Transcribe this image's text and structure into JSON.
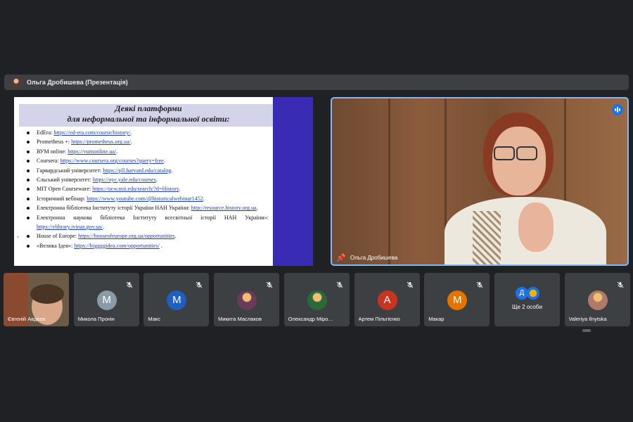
{
  "presenter_bar": {
    "title": "Ольга Дробишева (Презентація)"
  },
  "slide": {
    "heading_line1": "Деякі платформи",
    "heading_line2": "для неформальної та інформальної освіти:",
    "items": [
      {
        "prefix": "EdEra: ",
        "link": "https://ed-era.com/course/history/",
        "suffix": "."
      },
      {
        "prefix": "Prometheus +: ",
        "link": "https://prometheus.org.ua/",
        "suffix": "."
      },
      {
        "prefix": "ВУМ online: ",
        "link": "https://vumonline.ua/",
        "suffix": "."
      },
      {
        "prefix": "Coursera: ",
        "link": "https://www.coursera.org/courses?query=free",
        "suffix": "."
      },
      {
        "prefix": "Гарвардський університет: ",
        "link": "https://pll.harvard.edu/catalog",
        "suffix": "."
      },
      {
        "prefix": "Єльський університет: ",
        "link": "https://oyc.yale.edu/courses",
        "suffix": "."
      },
      {
        "prefix": "MIT Open Courseware: ",
        "link": "https://ocw.mit.edu/search/?d=History",
        "suffix": "."
      },
      {
        "prefix": "Історичний вебінар: ",
        "link": "https://www.youtube.com/@historicalwebinar1452",
        "suffix": "."
      },
      {
        "prefix": "Електронна бібліотека Інституту історії України НАН України: ",
        "link": "http://resource.history.org.ua",
        "suffix": "."
      },
      {
        "prefix": "Електронна наукова бібліотека Інституту всесвітньої історії НАН України»: ",
        "link": "https://elibrary.ivinas.gov.ua/",
        "suffix": "."
      },
      {
        "prefix": "House of Europe: ",
        "link": "https://houseofeurope.org.ua/opportunities",
        "suffix": "."
      },
      {
        "prefix": "«Велика Ідея»: ",
        "link": "https://biggggidea.com/opportunities/",
        "suffix": " ."
      }
    ]
  },
  "speaker": {
    "name": "Ольга Дробишева"
  },
  "participants": [
    {
      "name": "Євгеній Авдєєв",
      "initial": "",
      "color": "",
      "video": true
    },
    {
      "name": "Микола Пронін",
      "initial": "М",
      "color": "#8a9ba8"
    },
    {
      "name": "Макс",
      "initial": "М",
      "color": "#1f5fbf"
    },
    {
      "name": "Микита Маслаков",
      "initial": "",
      "color": "#6a3a5a"
    },
    {
      "name": "Олександр Міро…",
      "initial": "",
      "color": "#2a6a3a"
    },
    {
      "name": "Артем Пільтієнко",
      "initial": "А",
      "color": "#c5351f"
    },
    {
      "name": "Макар",
      "initial": "М",
      "color": "#e37400"
    },
    {
      "name": "Ще 2 особи",
      "initial": "Д",
      "color": "#1a73e8"
    },
    {
      "name": "Valeriya Ilnytska",
      "initial": "",
      "color": "#b07a6a"
    }
  ],
  "colors": {
    "background": "#202124",
    "tile": "#3c4043",
    "active_speaker_border": "#8ab4f8",
    "slide_accent": "#3a2bb5"
  }
}
